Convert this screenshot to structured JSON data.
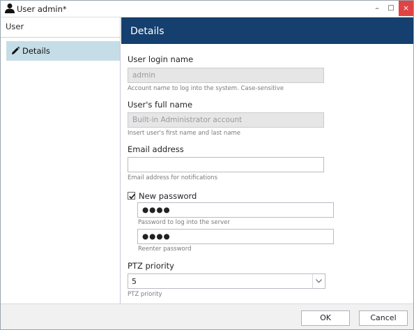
{
  "window": {
    "title": "User admin*",
    "minimize": "–",
    "maximize": "□",
    "close": "×"
  },
  "sidebar": {
    "title": "User",
    "items": [
      {
        "label": "Details",
        "icon": "pencil-icon",
        "selected": true
      }
    ]
  },
  "main": {
    "header": "Details",
    "login": {
      "label": "User login name",
      "value": "admin",
      "hint": "Account name to log into the system. Case-sensitive"
    },
    "fullname": {
      "label": "User's full name",
      "value": "Built-in Administrator account",
      "hint": "Insert user's first name and last name"
    },
    "email": {
      "label": "Email address",
      "value": "",
      "hint": "Email address for notifications"
    },
    "new_password": {
      "label": "New password",
      "checked": true,
      "password_value": "●●●●",
      "password_hint": "Password to log into the server",
      "reenter_value": "●●●●",
      "reenter_hint": "Reenter password"
    },
    "ptz": {
      "label": "PTZ priority",
      "value": "5",
      "hint": "PTZ priority"
    }
  },
  "footer": {
    "ok_label": "OK",
    "cancel_label": "Cancel"
  },
  "colors": {
    "header_bg": "#143f6e",
    "selected_item_bg": "#c5dde6",
    "close_button_bg": "#e04343"
  }
}
